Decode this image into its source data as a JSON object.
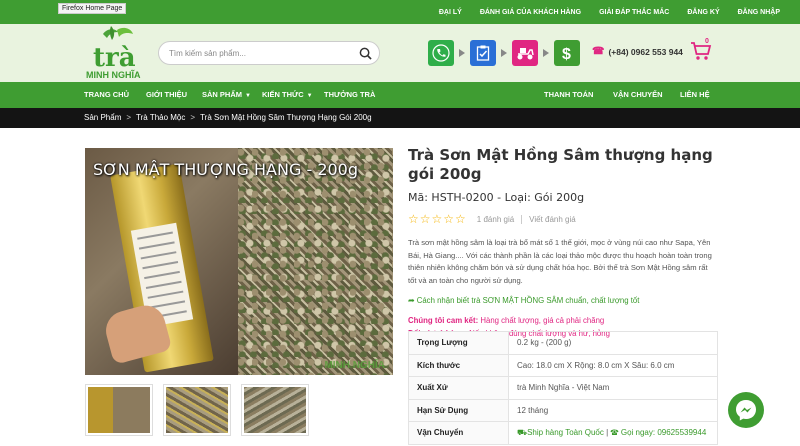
{
  "browser": {
    "tooltip": "Firefox Home Page"
  },
  "topbar": {
    "links": [
      "ĐẠI LÝ",
      "ĐÁNH GIÁ CỦA KHÁCH HÀNG",
      "GIẢI ĐÁP THẮC MẮC",
      "ĐĂNG KÝ",
      "ĐĂNG NHẬP"
    ]
  },
  "header": {
    "logo_icon": "tra-minh-nghia-logo",
    "search_placeholder": "Tìm kiếm sản phẩm...",
    "steps": [
      {
        "icon": "phone-call-icon",
        "color": "#2fae4a"
      },
      {
        "icon": "clipboard-check-icon",
        "color": "#2a6fd6"
      },
      {
        "icon": "delivery-scooter-icon",
        "color": "#e02682"
      },
      {
        "icon": "dollar-icon",
        "color": "#3f9d32"
      }
    ],
    "phone": "(+84) 0962 553 944",
    "cart_count": "0"
  },
  "nav": {
    "items": [
      "TRANG CHỦ",
      "GIỚI THIỆU",
      "SẢN PHẨM",
      "KIẾN THỨC",
      "THƯỞNG TRÀ",
      "THANH TOÁN",
      "VẬN CHUYỂN",
      "LIÊN HỆ"
    ]
  },
  "breadcrumb": [
    "Sản Phẩm",
    "Trà Thảo Mộc",
    "Trà Sơn Mật Hồng Sâm Thượng Hạng Gói 200g"
  ],
  "gallery": {
    "main_caption": "SƠN MẬT THƯỢNG HẠNG - 200g"
  },
  "product": {
    "title": "Trà Sơn Mật Hồng Sâm thượng hạng gói 200g",
    "code": "Mã: HSTH-0200 - Loại: Gói 200g",
    "stars": "☆☆☆☆☆",
    "rating_count": "1 đánh giá",
    "write_review": "Viết đánh giá",
    "description": "Trà sơn mật hồng sâm là loại trà bổ mát số 1 thế giới, mọc ở vùng núi cao như Sapa, Yên Bái, Hà Giang.... Với các thành phần là các loại thảo mộc được thu hoạch hoàn toàn trong thiên nhiên không chăm bón và sử dụng chất hóa học. Bởi thế trà Sơn Mật Hồng sâm rất tốt và an toàn cho người sử dụng.",
    "howto": "Cách nhận biết trà SƠN MẬT HỒNG SÂM chuẩn, chất lượng tốt",
    "commit_label": "Chúng tôi cam kết:",
    "commit_text": " Hàng chất lượng, giá cả phải chăng",
    "return_label": "Đổi và trả hàng:",
    "return_text": " Nếu không đúng chất lượng và hư, hỏng"
  },
  "specs": [
    {
      "key": "Trọng Lượng",
      "value": "0.2 kg - (200 g)"
    },
    {
      "key": "Kích thước",
      "value": "Cao: 18.0 cm X Rộng: 8.0 cm X Sâu: 6.0 cm"
    },
    {
      "key": "Xuất Xứ",
      "value": "trà Minh Nghĩa - Việt Nam"
    },
    {
      "key": "Hạn Sử Dụng",
      "value": "12 tháng"
    },
    {
      "key": "Vận Chuyển",
      "ship": "Ship hàng Toàn Quốc",
      "call": "Gọi ngay: 09625539944"
    }
  ],
  "colors": {
    "brand_green": "#3f9d32",
    "accent_pink": "#e02682",
    "star": "#f5b301"
  }
}
